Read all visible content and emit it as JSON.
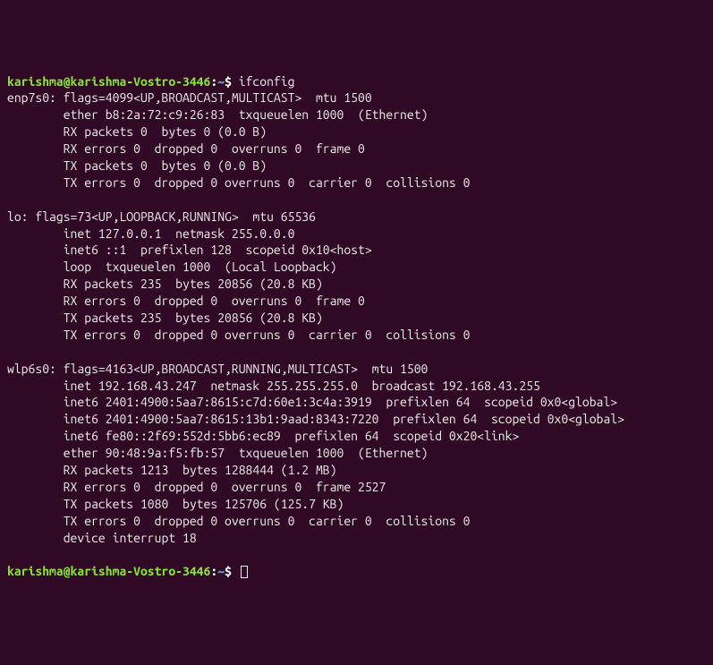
{
  "prompt": {
    "user_host": "karishma@karishma-Vostro-3446",
    "colon": ":",
    "path": "~",
    "dollar": "$ "
  },
  "command": "ifconfig",
  "output_lines": [
    "enp7s0: flags=4099<UP,BROADCAST,MULTICAST>  mtu 1500",
    "        ether b8:2a:72:c9:26:83  txqueuelen 1000  (Ethernet)",
    "        RX packets 0  bytes 0 (0.0 B)",
    "        RX errors 0  dropped 0  overruns 0  frame 0",
    "        TX packets 0  bytes 0 (0.0 B)",
    "        TX errors 0  dropped 0 overruns 0  carrier 0  collisions 0",
    "",
    "lo: flags=73<UP,LOOPBACK,RUNNING>  mtu 65536",
    "        inet 127.0.0.1  netmask 255.0.0.0",
    "        inet6 ::1  prefixlen 128  scopeid 0x10<host>",
    "        loop  txqueuelen 1000  (Local Loopback)",
    "        RX packets 235  bytes 20856 (20.8 KB)",
    "        RX errors 0  dropped 0  overruns 0  frame 0",
    "        TX packets 235  bytes 20856 (20.8 KB)",
    "        TX errors 0  dropped 0 overruns 0  carrier 0  collisions 0",
    "",
    "wlp6s0: flags=4163<UP,BROADCAST,RUNNING,MULTICAST>  mtu 1500",
    "        inet 192.168.43.247  netmask 255.255.255.0  broadcast 192.168.43.255",
    "        inet6 2401:4900:5aa7:8615:c7d:60e1:3c4a:3919  prefixlen 64  scopeid 0x0<global>",
    "        inet6 2401:4900:5aa7:8615:13b1:9aad:8343:7220  prefixlen 64  scopeid 0x0<global>",
    "        inet6 fe80::2f69:552d:5bb6:ec89  prefixlen 64  scopeid 0x20<link>",
    "        ether 90:48:9a:f5:fb:57  txqueuelen 1000  (Ethernet)",
    "        RX packets 1213  bytes 1288444 (1.2 MB)",
    "        RX errors 0  dropped 0  overruns 0  frame 2527",
    "        TX packets 1080  bytes 125706 (125.7 KB)",
    "        TX errors 0  dropped 0 overruns 0  carrier 0  collisions 0",
    "        device interrupt 18  ",
    ""
  ]
}
